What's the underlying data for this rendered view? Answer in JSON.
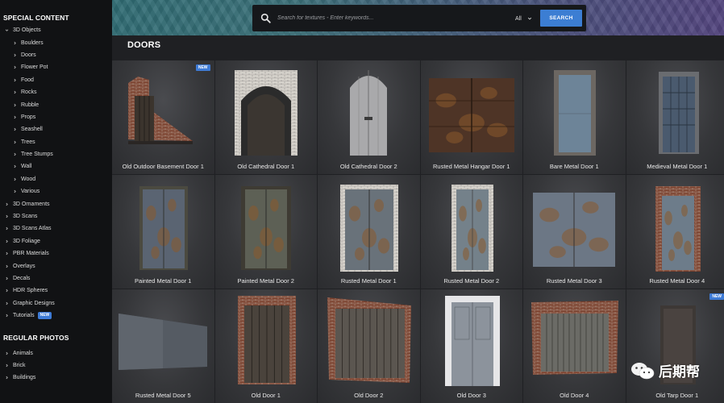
{
  "sidebar": {
    "special_title": "SPECIAL CONTENT",
    "items": [
      {
        "label": "3D Objects",
        "level": 0,
        "expanded": true
      },
      {
        "label": "Boulders",
        "level": 1
      },
      {
        "label": "Doors",
        "level": 1
      },
      {
        "label": "Flower Pot",
        "level": 1
      },
      {
        "label": "Food",
        "level": 1
      },
      {
        "label": "Rocks",
        "level": 1
      },
      {
        "label": "Rubble",
        "level": 1
      },
      {
        "label": "Props",
        "level": 1
      },
      {
        "label": "Seashell",
        "level": 1
      },
      {
        "label": "Trees",
        "level": 1
      },
      {
        "label": "Tree Stumps",
        "level": 1
      },
      {
        "label": "Wall",
        "level": 1
      },
      {
        "label": "Wood",
        "level": 1
      },
      {
        "label": "Various",
        "level": 1
      },
      {
        "label": "3D Ornaments",
        "level": 0
      },
      {
        "label": "3D Scans",
        "level": 0
      },
      {
        "label": "3D Scans Atlas",
        "level": 0
      },
      {
        "label": "3D Foliage",
        "level": 0
      },
      {
        "label": "PBR Materials",
        "level": 0
      },
      {
        "label": "Overlays",
        "level": 0
      },
      {
        "label": "Decals",
        "level": 0
      },
      {
        "label": "HDR Spheres",
        "level": 0
      },
      {
        "label": "Graphic Designs",
        "level": 0
      },
      {
        "label": "Tutorials",
        "level": 0,
        "badge": "NEW"
      }
    ],
    "regular_title": "REGULAR PHOTOS",
    "regular_items": [
      {
        "label": "Animals"
      },
      {
        "label": "Brick"
      },
      {
        "label": "Buildings"
      }
    ]
  },
  "search": {
    "placeholder": "Search for textures - Enter keywords...",
    "value": "",
    "scope": "All",
    "button_label": "SEARCH"
  },
  "page": {
    "title": "DOORS"
  },
  "items": [
    {
      "label": "Old Outdoor Basement Door 1",
      "badge": "NEW",
      "kind": "basement"
    },
    {
      "label": "Old Cathedral Door 1",
      "kind": "cathedral1"
    },
    {
      "label": "Old Cathedral Door 2",
      "kind": "cathedral2"
    },
    {
      "label": "Rusted Metal Hangar Door 1",
      "kind": "hangar"
    },
    {
      "label": "Bare Metal Door 1",
      "kind": "bare"
    },
    {
      "label": "Medieval Metal Door 1",
      "kind": "medieval"
    },
    {
      "label": "Painted Metal Door 1",
      "kind": "painted1"
    },
    {
      "label": "Painted Metal Door 2",
      "kind": "painted2"
    },
    {
      "label": "Rusted Metal Door 1",
      "kind": "rusted1"
    },
    {
      "label": "Rusted Metal Door 2",
      "kind": "rusted2"
    },
    {
      "label": "Rusted Metal Door 3",
      "kind": "rusted3"
    },
    {
      "label": "Rusted Metal Door 4",
      "kind": "rusted4"
    },
    {
      "label": "Rusted Metal Door 5",
      "badge": "",
      "kind": "rusted5"
    },
    {
      "label": "Old Door 1",
      "kind": "old1"
    },
    {
      "label": "Old Door 2",
      "kind": "old2"
    },
    {
      "label": "Old Door 3",
      "kind": "old3"
    },
    {
      "label": "Old Door 4",
      "kind": "old4"
    },
    {
      "label": "Old Tarp Door 1",
      "badge": "NEW",
      "kind": "tarp"
    }
  ],
  "watermark": {
    "text": "后期帮"
  },
  "colors": {
    "accent": "#3c7ed3",
    "sidebar_bg": "#111214",
    "main_bg": "#1f2023"
  },
  "icons": {
    "search": "search-icon",
    "chevron": "chevron-icon",
    "dropdown": "chevron-down-icon"
  }
}
